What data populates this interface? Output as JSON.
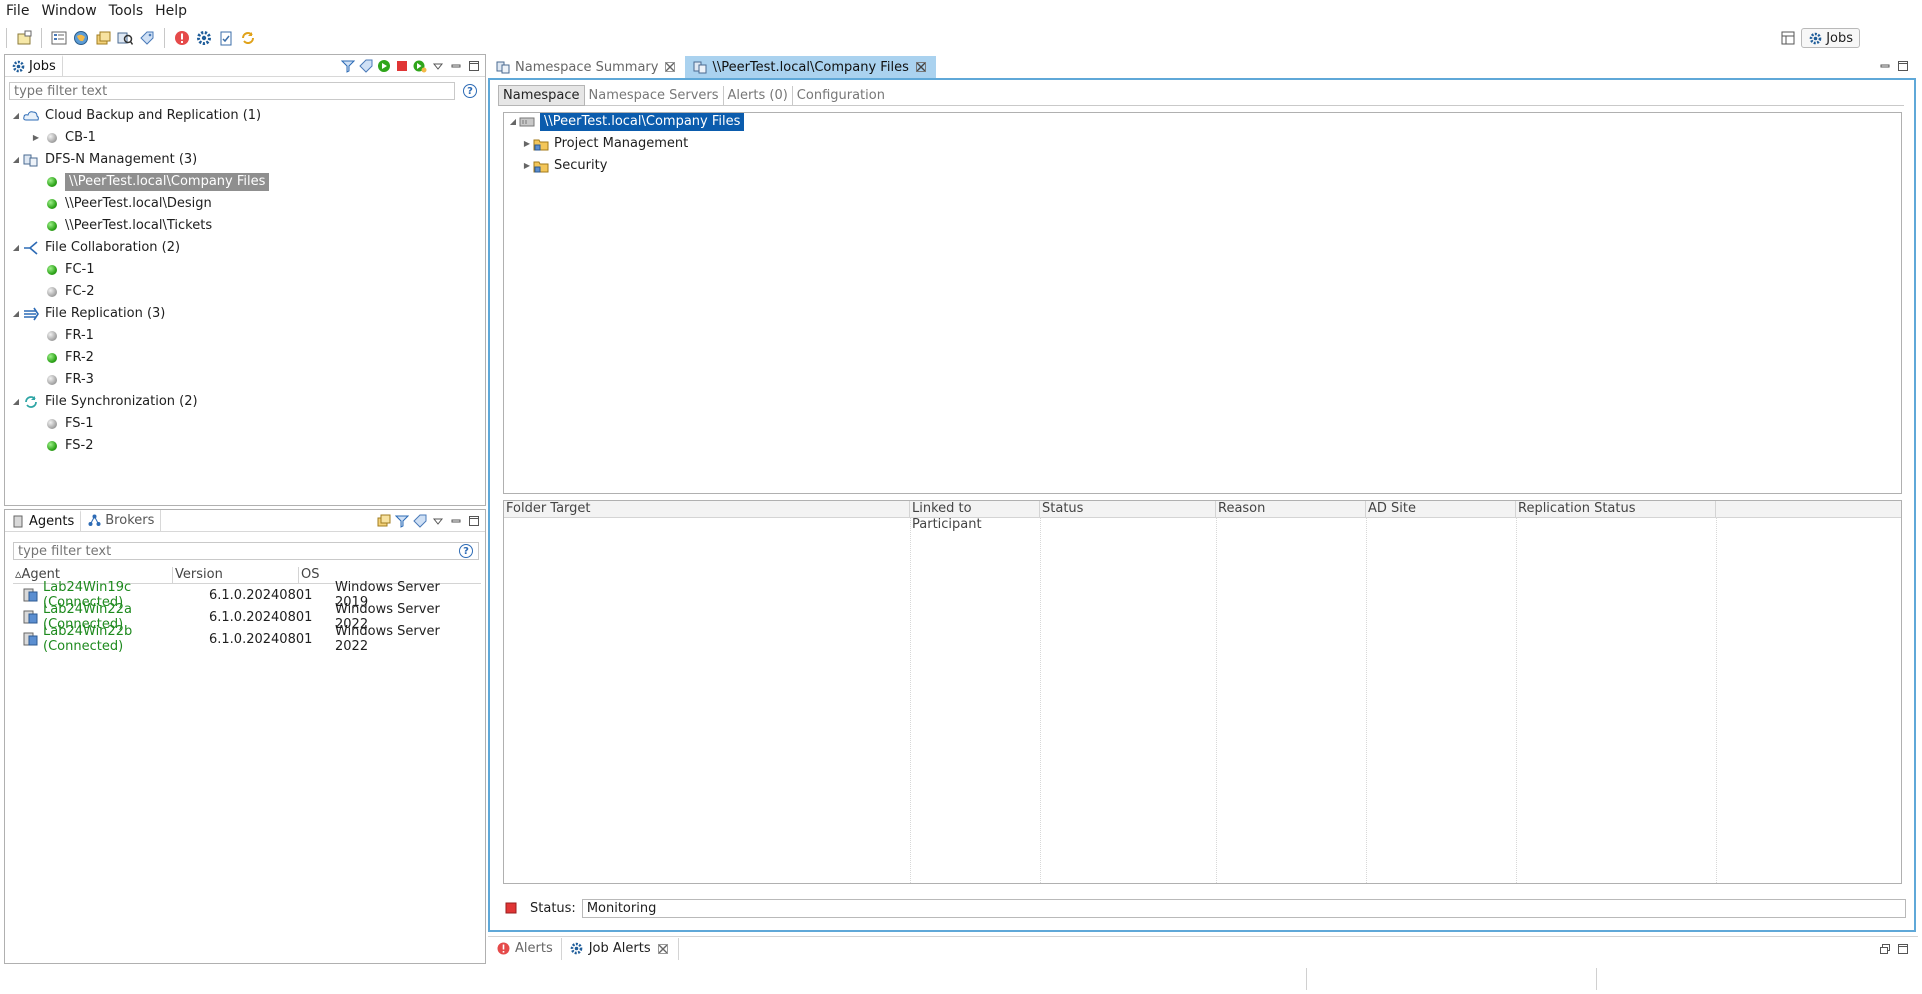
{
  "menu": [
    "File",
    "Window",
    "Tools",
    "Help"
  ],
  "perspective": {
    "label": "Jobs"
  },
  "jobs_view": {
    "tab_label": "Jobs",
    "filter_placeholder": "type filter text",
    "groups": [
      {
        "label": "Cloud Backup and Replication (1)",
        "icon": "cloud-icon",
        "items": [
          {
            "label": "CB-1",
            "status": "gray",
            "expandable": true
          }
        ]
      },
      {
        "label": "DFS-N Management (3)",
        "icon": "dfs-icon",
        "items": [
          {
            "label": "\\\\PeerTest.local\\Company Files",
            "status": "green",
            "selected": true
          },
          {
            "label": "\\\\PeerTest.local\\Design",
            "status": "green"
          },
          {
            "label": "\\\\PeerTest.local\\Tickets",
            "status": "green"
          }
        ]
      },
      {
        "label": "File Collaboration (2)",
        "icon": "collaboration-icon",
        "items": [
          {
            "label": "FC-1",
            "status": "green"
          },
          {
            "label": "FC-2",
            "status": "gray"
          }
        ]
      },
      {
        "label": "File Replication (3)",
        "icon": "replication-icon",
        "items": [
          {
            "label": "FR-1",
            "status": "gray"
          },
          {
            "label": "FR-2",
            "status": "green"
          },
          {
            "label": "FR-3",
            "status": "gray"
          }
        ]
      },
      {
        "label": "File Synchronization (2)",
        "icon": "sync-icon",
        "items": [
          {
            "label": "FS-1",
            "status": "gray"
          },
          {
            "label": "FS-2",
            "status": "green"
          }
        ]
      }
    ]
  },
  "agents_view": {
    "tabs": [
      "Agents",
      "Brokers"
    ],
    "filter_placeholder": "type filter text",
    "columns": [
      "Agent",
      "Version",
      "OS"
    ],
    "rows": [
      {
        "agent": "Lab24Win19c (Connected)",
        "version": "6.1.0.20240801",
        "os": "Windows Server 2019"
      },
      {
        "agent": "Lab24Win22a (Connected)",
        "version": "6.1.0.20240801",
        "os": "Windows Server 2022"
      },
      {
        "agent": "Lab24Win22b (Connected)",
        "version": "6.1.0.20240801",
        "os": "Windows Server 2022"
      }
    ]
  },
  "editor": {
    "tabs": [
      {
        "label": "Namespace Summary"
      },
      {
        "label": "\\\\PeerTest.local\\Company Files",
        "active": true
      }
    ],
    "subtabs": [
      "Namespace",
      "Namespace Servers",
      "Alerts (0)",
      "Configuration"
    ],
    "namespace_tree": {
      "root": "\\\\PeerTest.local\\Company Files",
      "children": [
        "Project Management",
        "Security"
      ]
    },
    "table_columns": [
      "Folder Target",
      "Linked to Participant",
      "Status",
      "Reason",
      "AD Site",
      "Replication Status"
    ],
    "status_label": "Status:",
    "status_value": "Monitoring"
  },
  "bottom_tabs": [
    "Alerts",
    "Job Alerts"
  ],
  "colors": {
    "accent": "#0b5cad",
    "connected_text": "#1e8a1e",
    "active_tab": "#aad2ef"
  }
}
